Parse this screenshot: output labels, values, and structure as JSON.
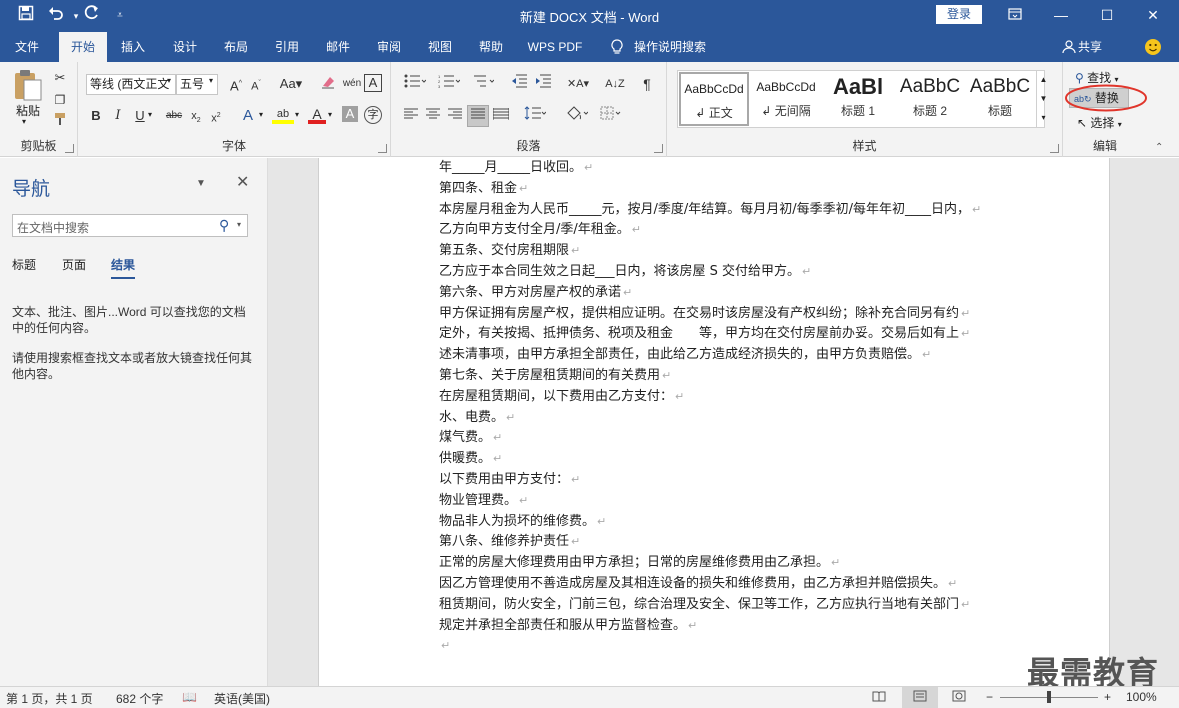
{
  "titlebar": {
    "title": "新建 DOCX 文档 - Word",
    "login": "登录",
    "save_icon": "save-icon",
    "undo_icon": "undo-icon",
    "redo_icon": "redo-icon",
    "customize_icon": "customize-quick-access-icon"
  },
  "tabs": [
    "文件",
    "开始",
    "插入",
    "设计",
    "布局",
    "引用",
    "邮件",
    "审阅",
    "视图",
    "帮助",
    "WPS PDF",
    "操作说明搜索"
  ],
  "share": "共享",
  "ribbon": {
    "clipboard": {
      "label": "剪贴板",
      "paste": "粘贴"
    },
    "font": {
      "label": "字体",
      "font_name": "等线 (西文正文",
      "font_size": "五号",
      "text_effect": "A",
      "highlight": "ab",
      "font_color": "A"
    },
    "paragraph": {
      "label": "段落"
    },
    "styles": {
      "label": "样式",
      "items": [
        {
          "preview": "AaBbCcDd",
          "name": "正文"
        },
        {
          "preview": "AaBbCcDd",
          "name": "无间隔"
        },
        {
          "preview": "AaBl",
          "name": "标题 1"
        },
        {
          "preview": "AaBbC",
          "name": "标题 2"
        },
        {
          "preview": "AaBbC",
          "name": "标题"
        }
      ]
    },
    "editing": {
      "label": "编辑",
      "find": "查找",
      "replace": "替换",
      "select": "选择"
    }
  },
  "nav": {
    "title": "导航",
    "search_placeholder": "在文档中搜索",
    "tabs": [
      "标题",
      "页面",
      "结果"
    ],
    "info1": "文本、批注、图片...Word 可以查找您的文档中的任何内容。",
    "info2": "请使用搜索框查找文本或者放大镜查找任何其他内容。"
  },
  "document": {
    "paragraphs": [
      "年_____月_____日收回。",
      "第四条、租金",
      "本房屋月租金为人民币_____元，按月/季度/年结算。每月月初/每季季初/每年年初____日内，",
      "乙方向甲方支付全月/季/年租金。",
      "第五条、交付房租期限",
      "乙方应于本合同生效之日起___日内，将该房屋 S 交付给甲方。",
      "第六条、甲方对房屋产权的承诺",
      "甲方保证拥有房屋产权，提供相应证明。在交易时该房屋没有产权纠纷；除补充合同另有约",
      "定外，有关按揭、抵押债务、税项及租金　　等，甲方均在交付房屋前办妥。交易后如有上",
      "述未清事项，由甲方承担全部责任，由此给乙方造成经济损失的，由甲方负责赔偿。",
      "第七条、关于房屋租赁期间的有关费用",
      "在房屋租赁期间，以下费用由乙方支付：",
      "水、电费。",
      "煤气费。",
      "供暖费。",
      "以下费用由甲方支付：",
      "物业管理费。",
      "物品非人为损坏的维修费。",
      "第八条、维修养护责任",
      "正常的房屋大修理费用由甲方承担；日常的房屋维修费用由乙承担。",
      "因乙方管理使用不善造成房屋及其相连设备的损失和维修费用，由乙方承担并赔偿损失。",
      "租赁期间，防火安全，门前三包，综合治理及安全、保卫等工作，乙方应执行当地有关部门",
      "规定并承担全部责任和服从甲方监督检查。",
      ""
    ],
    "paragraph_mark": "↵"
  },
  "status": {
    "page": "第 1 页，共 1 页",
    "words": "682 个字",
    "language": "英语(美国)",
    "zoom": "100%"
  },
  "watermark": "最需教育",
  "colors": {
    "brand": "#2b579a",
    "annotation": "#e0352b"
  }
}
